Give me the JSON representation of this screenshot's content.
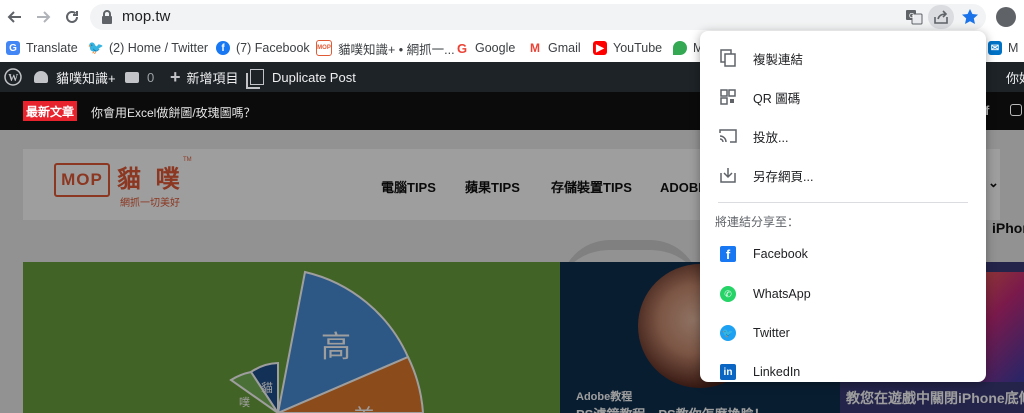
{
  "browser": {
    "url": "mop.tw",
    "icons": [
      "back-icon",
      "forward-icon",
      "reload-icon",
      "lock-icon",
      "translate-icon",
      "share-icon",
      "star-icon",
      "profile-icon"
    ]
  },
  "bookmarks": [
    {
      "label": "Translate",
      "icon": "google-translate-icon"
    },
    {
      "label": "(2) Home / Twitter",
      "icon": "twitter-icon"
    },
    {
      "label": "(7) Facebook",
      "icon": "facebook-icon"
    },
    {
      "label": "貓噗知識+ • 網抓一...",
      "icon": "mop-icon"
    },
    {
      "label": "Google",
      "icon": "google-icon"
    },
    {
      "label": "Gmail",
      "icon": "gmail-icon"
    },
    {
      "label": "YouTube",
      "icon": "youtube-icon"
    },
    {
      "label": "M",
      "icon": "maps-icon"
    },
    {
      "label": "M",
      "icon": "mail-icon"
    }
  ],
  "wpbar": {
    "site": "貓噗知識+",
    "comments": "0",
    "new": "新增項目",
    "duplicate": "Duplicate Post",
    "user": "你好"
  },
  "ticker": {
    "badge": "最新文章",
    "text": "你會用Excel做餅圖/玫瑰圖嗎？"
  },
  "site": {
    "logo_text": "MOP",
    "logo_cn": "貓 噗",
    "slogan": "網抓一切美好",
    "tm": "TM",
    "menu": [
      "電腦TIPS",
      "蘋果TIPS",
      "存儲裝置TIPS",
      "ADOBE教"
    ],
    "hero_center_category": "Adobe教程",
    "hero_center_title": "PS濾鏡教程，PS教你怎麼換臉！",
    "hero_right_title": "教您在遊戲中關閉iPhone底條",
    "hero_right_extra": "iPhone底",
    "pie_labels": [
      "高",
      "貓",
      "噗",
      "美"
    ]
  },
  "popup": {
    "items": [
      {
        "label": "複製連結",
        "icon": "copy-icon"
      },
      {
        "label": "QR 圖碼",
        "icon": "qr-code-icon"
      },
      {
        "label": "投放...",
        "icon": "cast-icon"
      },
      {
        "label": "另存網頁...",
        "icon": "save-page-icon"
      }
    ],
    "share_heading": "將連結分享至：",
    "share_items": [
      {
        "label": "Facebook",
        "icon": "facebook-icon",
        "color": "#1877f2"
      },
      {
        "label": "WhatsApp",
        "icon": "whatsapp-icon",
        "color": "#25d366"
      },
      {
        "label": "Twitter",
        "icon": "twitter-icon",
        "color": "#1da1f2"
      },
      {
        "label": "LinkedIn",
        "icon": "linkedin-icon",
        "color": "#0a66c2"
      }
    ]
  },
  "colors": {
    "accent": "#1a73e8",
    "wpbar": "#1d2327",
    "badge": "#e8232d",
    "logo": "#e05a36"
  }
}
